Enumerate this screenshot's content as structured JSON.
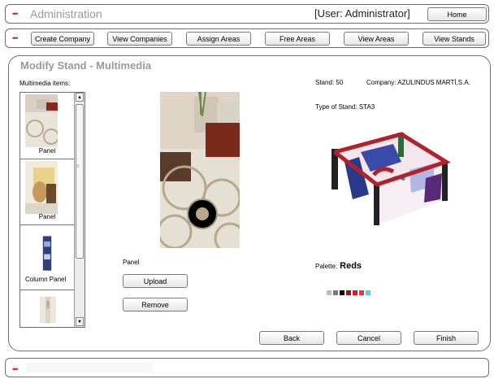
{
  "header": {
    "title": "Administration",
    "user": "[User: Administrator]",
    "home_label": "Home"
  },
  "nav": {
    "items": [
      "Create Company",
      "View Companies",
      "Assign Areas",
      "Free Areas",
      "View Areas",
      "View Stands"
    ]
  },
  "panel": {
    "title": "Modify Stand - Multimedia",
    "multimedia_label": "Multimedia items:",
    "items": [
      {
        "label": "Panel"
      },
      {
        "label": "Panel"
      },
      {
        "label": "Column Panel"
      }
    ],
    "selected_item_name": "Panel",
    "upload_label": "Upload",
    "remove_label": "Remove",
    "stand": "Stand: 50",
    "company": "Company: AZULINDUS MARTÍ,S.A.",
    "stand_type": "Type of Stand: STA3",
    "palette_label": "Palette:",
    "palette_name": "Reds",
    "palette_colors": [
      "#ffffff",
      "#bdbdbd",
      "#7a7a7a",
      "#000000",
      "#8b1a1a",
      "#d01e2a",
      "#e53948",
      "#57d0ea"
    ],
    "back_label": "Back",
    "cancel_label": "Cancel",
    "finish_label": "Finish"
  },
  "colors": {
    "accent_dots": "#c8202a",
    "title_gray": "#9a9a9a",
    "stand_frame": "#b2222c"
  }
}
